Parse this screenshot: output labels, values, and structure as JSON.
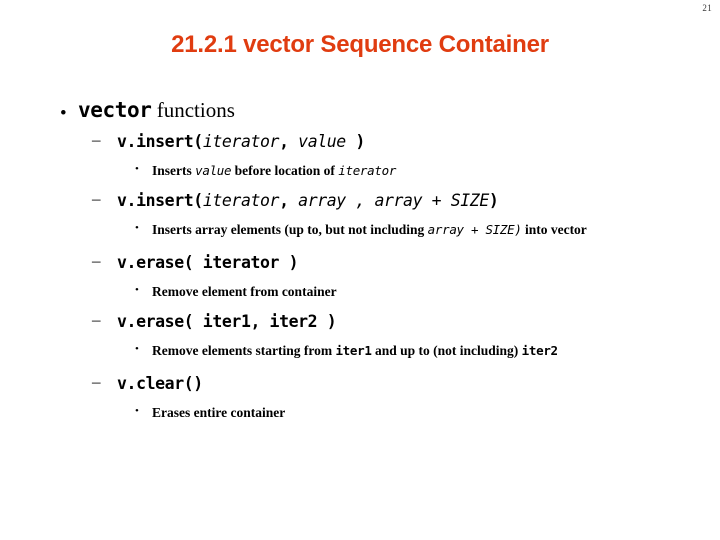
{
  "slide": {
    "page_number": "21",
    "title": "21.2.1 vector Sequence Container",
    "title_color": "#e03c10",
    "background_color": "#ffffff",
    "text_color": "#000000"
  },
  "markers": {
    "level1": "•",
    "level2": "–",
    "level3": "•"
  },
  "outline": {
    "heading": {
      "code": "vector",
      "rest": " functions"
    },
    "items": [
      {
        "signature": {
          "call": "v.insert(",
          "arg1": "iterator",
          "sep1": ", ",
          "arg2": "value",
          "close": " )"
        },
        "notes": [
          {
            "part1": "Inserts ",
            "em1": "value",
            "part2": " before location of ",
            "em2": "iterator",
            "part3": ""
          }
        ]
      },
      {
        "signature": {
          "call": "v.insert(",
          "arg1": "iterator",
          "sep1": ",  ",
          "arg2": "array",
          "sep2": " , ",
          "arg3": "array + SIZE",
          "close": ")"
        },
        "notes": [
          {
            "part1": "Inserts array elements (up to, but not including ",
            "em1": "array + SIZE)",
            "part2": " into vector",
            "em2": "",
            "part3": ""
          }
        ]
      },
      {
        "signature": {
          "call": "v.erase( iterator )"
        },
        "notes": [
          {
            "part1": "Remove element from container",
            "em1": "",
            "part2": "",
            "em2": "",
            "part3": ""
          }
        ]
      },
      {
        "signature": {
          "call": "v.erase( iter1, iter2 )"
        },
        "notes": [
          {
            "part1": "Remove elements starting from ",
            "em1": "iter1",
            "part2": " and up to (not including) ",
            "em2": "iter2",
            "part3": ""
          }
        ]
      },
      {
        "signature": {
          "call": "v.clear()"
        },
        "notes": [
          {
            "part1": "Erases entire container",
            "em1": "",
            "part2": "",
            "em2": "",
            "part3": ""
          }
        ]
      }
    ]
  }
}
